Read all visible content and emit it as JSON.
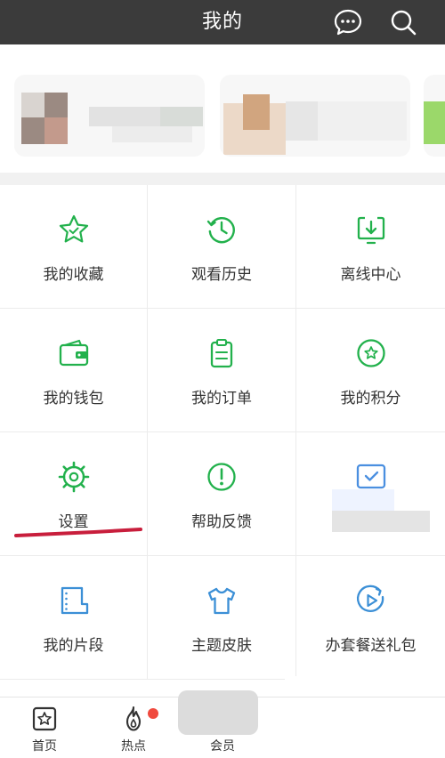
{
  "header": {
    "title": "我的",
    "icons": [
      "message-icon",
      "search-icon"
    ]
  },
  "grid": {
    "items": [
      {
        "label": "我的收藏",
        "icon": "star-icon"
      },
      {
        "label": "观看历史",
        "icon": "history-icon"
      },
      {
        "label": "离线中心",
        "icon": "download-icon"
      },
      {
        "label": "我的钱包",
        "icon": "wallet-icon"
      },
      {
        "label": "我的订单",
        "icon": "order-icon"
      },
      {
        "label": "我的积分",
        "icon": "points-icon"
      },
      {
        "label": "设置",
        "icon": "gear-icon"
      },
      {
        "label": "帮助反馈",
        "icon": "help-icon"
      },
      {
        "label": "",
        "icon": "blurred-icon"
      },
      {
        "label": "我的片段",
        "icon": "clip-icon"
      },
      {
        "label": "主题皮肤",
        "icon": "tshirt-icon"
      },
      {
        "label": "办套餐送礼包",
        "icon": "play-icon"
      }
    ]
  },
  "tabbar": {
    "tabs": [
      {
        "label": "首页",
        "icon": "home-icon"
      },
      {
        "label": "热点",
        "icon": "fire-icon",
        "badge": true
      },
      {
        "label": "会员",
        "icon": "vip-icon"
      }
    ]
  },
  "colors": {
    "accent": "#22b14c",
    "header_bg": "#3b3b3b",
    "badge": "#f04a3e",
    "annotation": "#c81e3c"
  }
}
